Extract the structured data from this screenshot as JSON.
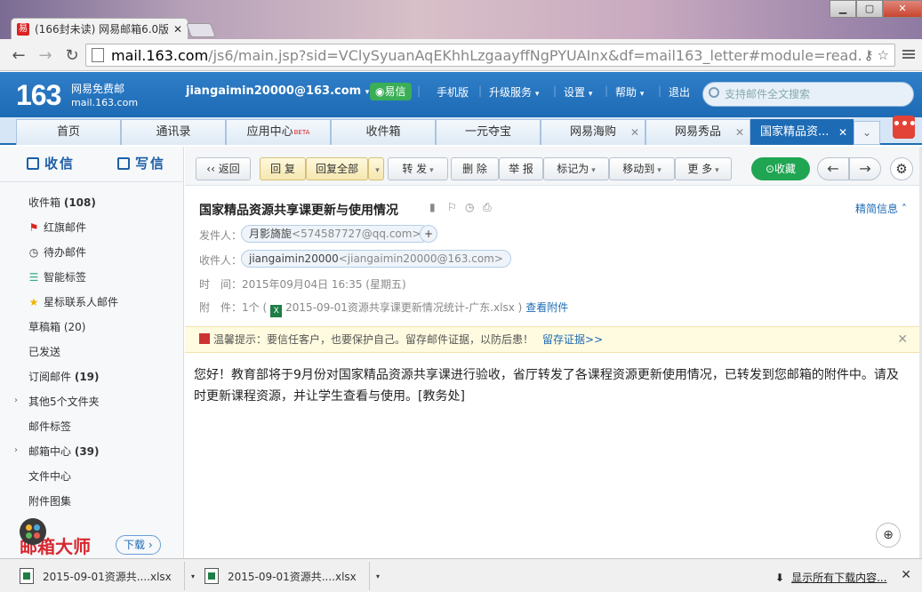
{
  "browser": {
    "tab_title": "(166封未读) 网易邮箱6.0版",
    "tab_favicon": "易",
    "url_host": "mail.163.com",
    "url_path": "/js6/main.jsp?sid=VClySyuanAqEKhhLzgaayffNgPYUAInx&df=mail163_letter#module=read.ReadModule"
  },
  "header": {
    "logo": "163",
    "logo_line1": "网易免费邮",
    "logo_line2": "mail.163.com",
    "user": "jiangaimin20000@163.com",
    "user_caret": "▾",
    "yixin": "易信",
    "links": [
      "手机版",
      "升级服务",
      "设置",
      "帮助",
      "退出"
    ],
    "search_placeholder": "支持邮件全文搜索"
  },
  "tabs": [
    {
      "label": "首页"
    },
    {
      "label": "通讯录"
    },
    {
      "label": "应用中心",
      "badge": "BETA"
    },
    {
      "label": "收件箱"
    },
    {
      "label": "一元夺宝"
    },
    {
      "label": "网易海购"
    },
    {
      "label": "网易秀品"
    },
    {
      "label": "国家精品资..."
    }
  ],
  "more_tab": "•••",
  "sidebar": {
    "receive": "收信",
    "compose": "写信",
    "folders": [
      {
        "label": "收件箱",
        "count": "(108)"
      },
      {
        "label": "红旗邮件",
        "count": ""
      },
      {
        "label": "待办邮件",
        "count": ""
      },
      {
        "label": "智能标签",
        "count": ""
      },
      {
        "label": "星标联系人邮件",
        "count": ""
      },
      {
        "label": "草稿箱",
        "count": "(20)"
      },
      {
        "label": "已发送",
        "count": ""
      },
      {
        "label": "订阅邮件",
        "count": "(19)"
      },
      {
        "label": "其他5个文件夹",
        "count": ""
      },
      {
        "label": "邮件标签",
        "count": ""
      },
      {
        "label": "邮箱中心",
        "count": "(39)"
      },
      {
        "label": "文件中心",
        "count": ""
      },
      {
        "label": "附件图集",
        "count": ""
      }
    ],
    "promo": "邮箱大师",
    "promo_download": "下载"
  },
  "toolbar": {
    "back": "返回",
    "reply": "回 复",
    "reply_all": "回复全部",
    "forward": "转 发",
    "delete": "删 除",
    "report": "举 报",
    "mark_as": "标记为",
    "move_to": "移动到",
    "more": "更 多",
    "collect": "收藏"
  },
  "mail": {
    "subject": "国家精品资源共享课更新与使用情况",
    "simple_info": "精简信息",
    "from_label": "发件人：",
    "from_name": "月影旖旎",
    "from_email": "<574587727@qq.com>",
    "to_label": "收件人：",
    "to_name": "jiangaimin20000",
    "to_email": "<jiangaimin20000@163.com>",
    "time_label": "时　间：",
    "time_value": "2015年09月04日 16:35 (星期五)",
    "att_label": "附　件：",
    "att_count": "1个 (",
    "att_file": "2015-09-01资源共享课更新情况统计-广东.xlsx",
    "att_close": ")",
    "att_view": "查看附件",
    "warning": "温馨提示：要信任客户，也要保护自己。留存邮件证据，以防后患！",
    "warning_link": "留存证据>>",
    "body": "您好！教育部将于9月份对国家精品资源共享课进行验收，省厅转发了各课程资源更新使用情况，已转发到您邮箱的附件中。请及时更新课程资源，并让学生查看与使用。[教务处]"
  },
  "downloads": {
    "items": [
      "2015-09-01资源共....xlsx",
      "2015-09-01资源共....xlsx"
    ],
    "show_all": "显示所有下载内容..."
  }
}
